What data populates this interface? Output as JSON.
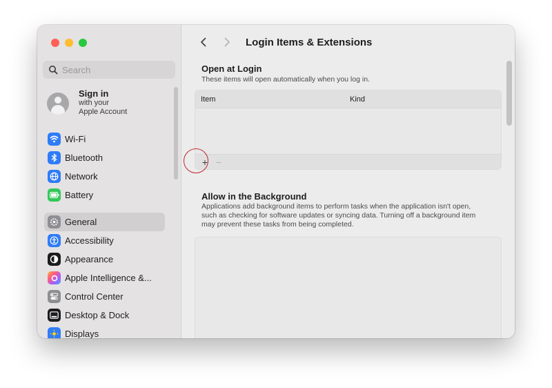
{
  "sidebar": {
    "search_placeholder": "Search",
    "account": {
      "title": "Sign in",
      "line1": "with your",
      "line2": "Apple Account"
    },
    "items_top": [
      {
        "label": "Wi-Fi",
        "icon": "wifi-icon",
        "color": "#2f7cf6"
      },
      {
        "label": "Bluetooth",
        "icon": "bluetooth-icon",
        "color": "#2f7cf6"
      },
      {
        "label": "Network",
        "icon": "globe-icon",
        "color": "#2f7cf6"
      },
      {
        "label": "Battery",
        "icon": "battery-icon",
        "color": "#34c759"
      }
    ],
    "items_bottom": [
      {
        "label": "General",
        "icon": "gear-icon",
        "color": "#8e8e93",
        "selected": true
      },
      {
        "label": "Accessibility",
        "icon": "accessibility-icon",
        "color": "#2f7cf6"
      },
      {
        "label": "Appearance",
        "icon": "appearance-icon",
        "color": "#1c1c1e"
      },
      {
        "label": "Apple Intelligence &...",
        "icon": "apple-intelligence-icon",
        "color": "#ff6d5a"
      },
      {
        "label": "Control Center",
        "icon": "control-center-icon",
        "color": "#8e8e93"
      },
      {
        "label": "Desktop & Dock",
        "icon": "dock-icon",
        "color": "#1c1c1e"
      },
      {
        "label": "Displays",
        "icon": "displays-icon",
        "color": "#2f7cf6"
      }
    ]
  },
  "toolbar": {
    "title": "Login Items & Extensions"
  },
  "open_at_login": {
    "title": "Open at Login",
    "desc": "These items will open automatically when you log in.",
    "col_item": "Item",
    "col_kind": "Kind",
    "add_label": "+",
    "remove_label": "−"
  },
  "background": {
    "title": "Allow in the Background",
    "desc": "Applications add background items to perform tasks when the application isn't open, such as checking for software updates or syncing data. Turning off a background item may prevent these tasks from being completed."
  }
}
